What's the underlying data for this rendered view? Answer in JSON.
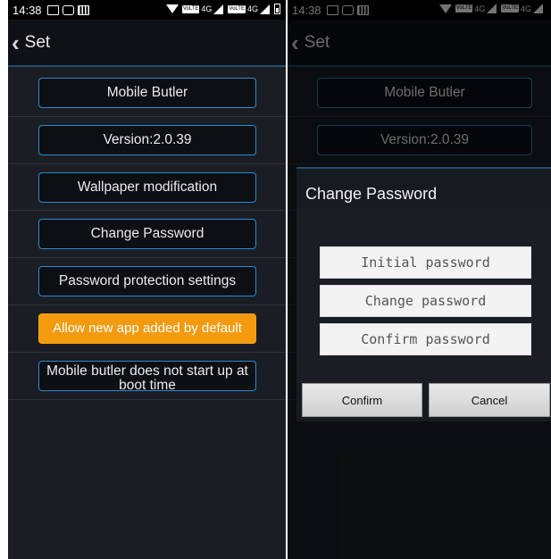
{
  "status_bar": {
    "time": "14:38",
    "volte_label": "VoLTE",
    "network_label": "4G",
    "icons": [
      "image-icon",
      "chat-icon",
      "barcode-icon",
      "wifi-icon",
      "signal-icon",
      "battery-icon"
    ]
  },
  "header": {
    "back_icon": "‹",
    "title": "Set"
  },
  "menu": {
    "items": [
      {
        "label": "Mobile Butler"
      },
      {
        "label": "Version:2.0.39"
      },
      {
        "label": "Wallpaper modification"
      },
      {
        "label": "Change Password"
      },
      {
        "label": "Password protection settings"
      },
      {
        "label": "Allow new app added by default",
        "active": true
      },
      {
        "label": "Mobile butler does not start up at boot time"
      }
    ]
  },
  "dialog": {
    "title": "Change Password",
    "fields": [
      {
        "placeholder": "Initial password"
      },
      {
        "placeholder": "Change password"
      },
      {
        "placeholder": "Confirm password"
      }
    ],
    "confirm_label": "Confirm",
    "cancel_label": "Cancel"
  },
  "colors": {
    "accent_border": "#2c8bd1",
    "active_orange": "#f39a0f",
    "background": "#1a1e24"
  }
}
